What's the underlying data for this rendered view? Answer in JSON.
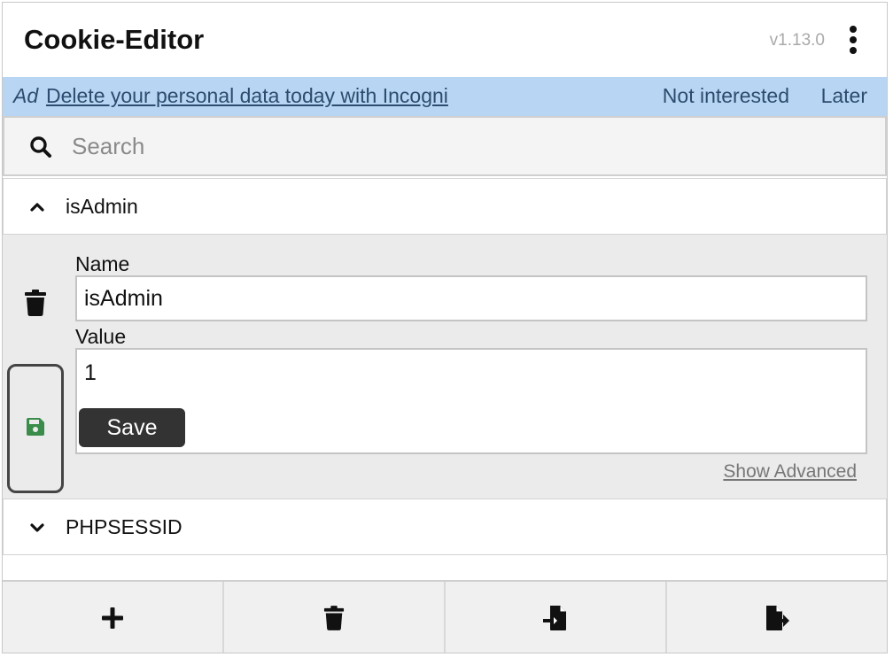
{
  "header": {
    "title": "Cookie-Editor",
    "version": "v1.13.0",
    "menu_icon": "kebab-menu-icon"
  },
  "ad": {
    "tag": "Ad",
    "link_text": "Delete your personal data today with Incogni",
    "not_interested": "Not interested",
    "later": "Later",
    "background": "#b8d6f3"
  },
  "search": {
    "placeholder": "Search",
    "value": "",
    "icon": "search-icon"
  },
  "cookies": [
    {
      "name": "isAdmin",
      "expanded": true
    },
    {
      "name": "PHPSESSID",
      "expanded": false
    }
  ],
  "editor": {
    "name_label": "Name",
    "name_value": "isAdmin",
    "value_label": "Value",
    "value_value": "1",
    "save_label": "Save",
    "show_advanced": "Show Advanced",
    "save_icon_color": "#3a8c4a"
  },
  "footer": {
    "buttons": [
      {
        "icon": "add-icon"
      },
      {
        "icon": "trash-icon"
      },
      {
        "icon": "import-icon"
      },
      {
        "icon": "export-icon"
      }
    ]
  }
}
